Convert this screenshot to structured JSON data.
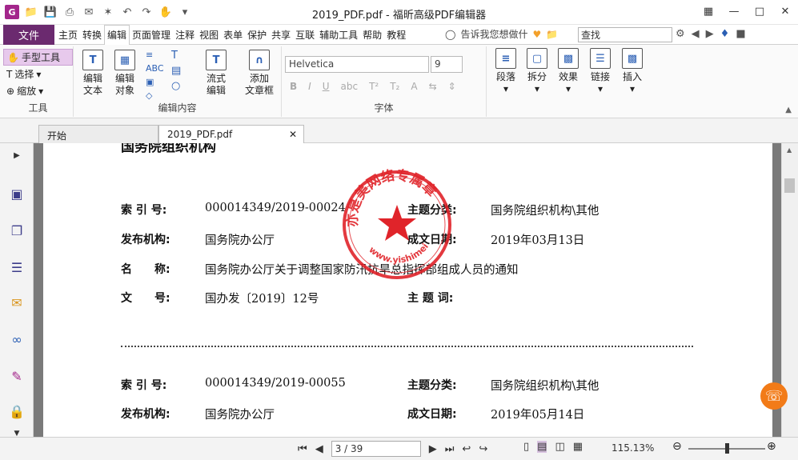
{
  "window": {
    "title": "2019_PDF.pdf - 福昕高级PDF编辑器"
  },
  "menu": {
    "file": "文件",
    "tabs": [
      "主页",
      "转换",
      "编辑",
      "页面管理",
      "注释",
      "视图",
      "表单",
      "保护",
      "共享",
      "互联",
      "辅助工具",
      "帮助",
      "教程"
    ],
    "active_tab": "编辑",
    "tell_me": "告诉我您想做什",
    "search_placeholder": "查找"
  },
  "ribbon": {
    "tools": {
      "hand": "手型工具",
      "select": "选择",
      "zoom": "缩放",
      "group": "工具"
    },
    "edit": {
      "edit_text": "编辑\n文本",
      "edit_object": "编辑\n对象",
      "flow_text": "流式\n编辑",
      "add_textbox": "添加\n文章框",
      "group": "编辑内容"
    },
    "font": {
      "family": "Helvetica",
      "size": "9",
      "group": "字体"
    },
    "para": {
      "paragraph": "段落",
      "split": "拆分",
      "effect": "效果",
      "link": "链接",
      "insert": "插入"
    }
  },
  "doc_tabs": [
    "开始",
    "2019_PDF.pdf"
  ],
  "document": {
    "heading_partial": "国务院组织机构",
    "records": [
      {
        "index_label": "索 引 号:",
        "index": "000014349/2019-00024",
        "topic_label": "主题分类:",
        "topic": "国务院组织机构\\其他",
        "publisher_label": "发布机构:",
        "publisher": "国务院办公厅",
        "date_label": "成文日期:",
        "date": "2019年03月13日",
        "name_label": "名　　称:",
        "name": "国务院办公厅关于调整国家防汛抗旱总指挥部组成人员的通知",
        "docno_label": "文　　号:",
        "docno": "国办发〔2019〕12号",
        "keywords_label": "主 题 词:"
      },
      {
        "index_label": "索 引 号:",
        "index": "000014349/2019-00055",
        "topic_label": "主题分类:",
        "topic": "国务院组织机构\\其他",
        "publisher_label": "发布机构:",
        "publisher": "国务院办公厅",
        "date_label": "成文日期:",
        "date": "2019年05月14日"
      }
    ],
    "stamp_text": "亦是美网络专属章",
    "stamp_url": "www.yishimei.cn"
  },
  "status": {
    "page": "3 / 39",
    "zoom": "115.13%"
  },
  "colors": {
    "brand": "#6b2a6f",
    "stamp": "#e0242a",
    "chat": "#f27b18"
  }
}
